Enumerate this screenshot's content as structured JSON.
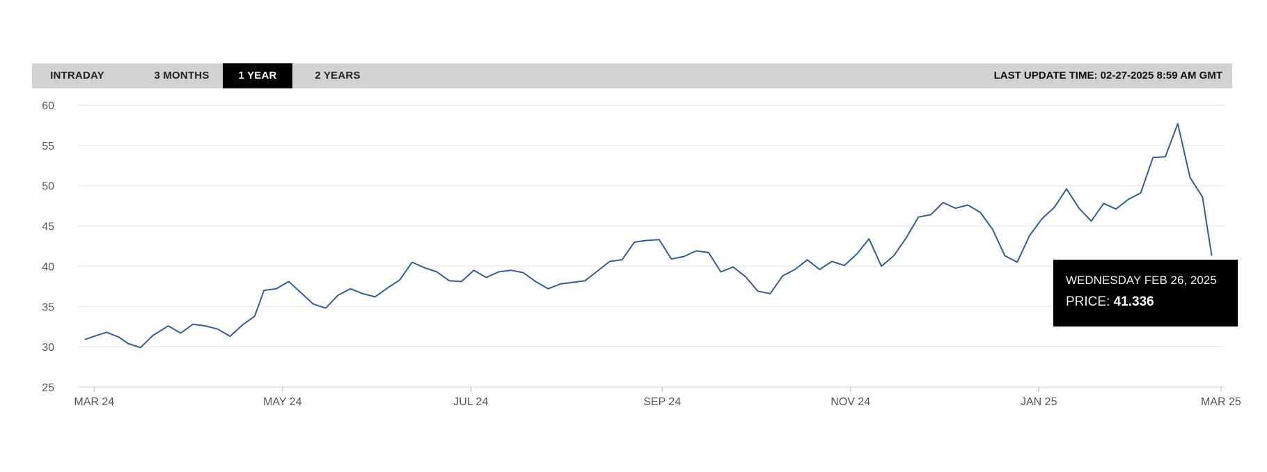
{
  "toolbar": {
    "tabs": [
      {
        "label": "INTRADAY",
        "active": false
      },
      {
        "label": "3 MONTHS",
        "active": false
      },
      {
        "label": "1 YEAR",
        "active": true
      },
      {
        "label": "2 YEARS",
        "active": false
      }
    ],
    "last_update": "LAST UPDATE TIME: 02-27-2025 8:59 AM GMT"
  },
  "tooltip": {
    "date": "WEDNESDAY FEB 26, 2025",
    "price_label": "PRICE:",
    "price_value": "41.336"
  },
  "colors": {
    "line": "#2f5d9e",
    "grid": "#e6e6e6",
    "toolbar": "#d2d2d2",
    "active_tab": "#000000"
  },
  "chart_data": {
    "type": "line",
    "ylim": [
      25,
      60
    ],
    "yticks": [
      25,
      30,
      35,
      40,
      45,
      50,
      55,
      60
    ],
    "xlim": [
      "2024-02-27",
      "2025-02-27"
    ],
    "xticks": [
      {
        "label": "MAR 24",
        "date": "2024-03-01"
      },
      {
        "label": "MAY 24",
        "date": "2024-05-01"
      },
      {
        "label": "JUL 24",
        "date": "2024-07-01"
      },
      {
        "label": "SEP 24",
        "date": "2024-09-01"
      },
      {
        "label": "NOV 24",
        "date": "2024-11-01"
      },
      {
        "label": "JAN 25",
        "date": "2025-01-01"
      },
      {
        "label": "MAR 25",
        "date": "2025-03-01"
      }
    ],
    "grid": true,
    "series": [
      {
        "x": [
          "2024-02-27",
          "2024-03-01",
          "2024-03-05",
          "2024-03-09",
          "2024-03-12",
          "2024-03-16",
          "2024-03-20",
          "2024-03-25",
          "2024-03-29",
          "2024-04-02",
          "2024-04-06",
          "2024-04-10",
          "2024-04-14",
          "2024-04-18",
          "2024-04-22",
          "2024-04-25",
          "2024-04-29",
          "2024-05-03",
          "2024-05-07",
          "2024-05-11",
          "2024-05-15",
          "2024-05-19",
          "2024-05-23",
          "2024-05-27",
          "2024-05-31",
          "2024-06-04",
          "2024-06-08",
          "2024-06-12",
          "2024-06-16",
          "2024-06-20",
          "2024-06-24",
          "2024-06-28",
          "2024-07-02",
          "2024-07-06",
          "2024-07-10",
          "2024-07-14",
          "2024-07-18",
          "2024-07-22",
          "2024-07-26",
          "2024-07-30",
          "2024-08-03",
          "2024-08-07",
          "2024-08-11",
          "2024-08-15",
          "2024-08-19",
          "2024-08-23",
          "2024-08-27",
          "2024-08-31",
          "2024-09-04",
          "2024-09-08",
          "2024-09-12",
          "2024-09-16",
          "2024-09-20",
          "2024-09-24",
          "2024-09-28",
          "2024-10-02",
          "2024-10-06",
          "2024-10-10",
          "2024-10-14",
          "2024-10-18",
          "2024-10-22",
          "2024-10-26",
          "2024-10-30",
          "2024-11-03",
          "2024-11-07",
          "2024-11-11",
          "2024-11-15",
          "2024-11-19",
          "2024-11-23",
          "2024-11-27",
          "2024-12-01",
          "2024-12-05",
          "2024-12-09",
          "2024-12-13",
          "2024-12-17",
          "2024-12-21",
          "2024-12-25",
          "2024-12-29",
          "2025-01-02",
          "2025-01-06",
          "2025-01-10",
          "2025-01-14",
          "2025-01-18",
          "2025-01-22",
          "2025-01-26",
          "2025-01-30",
          "2025-02-03",
          "2025-02-07",
          "2025-02-11",
          "2025-02-15",
          "2025-02-19",
          "2025-02-23",
          "2025-02-26"
        ],
        "y": [
          30.9,
          31.3,
          31.8,
          31.2,
          30.4,
          29.9,
          31.4,
          32.6,
          31.7,
          32.8,
          32.6,
          32.2,
          31.3,
          32.7,
          33.8,
          37.0,
          37.2,
          38.1,
          36.7,
          35.3,
          34.8,
          36.4,
          37.2,
          36.6,
          36.2,
          37.3,
          38.3,
          40.5,
          39.8,
          39.3,
          38.2,
          38.1,
          39.5,
          38.6,
          39.3,
          39.5,
          39.2,
          38.1,
          37.2,
          37.8,
          38.0,
          38.2,
          39.4,
          40.6,
          40.8,
          43.0,
          43.2,
          43.3,
          40.9,
          41.2,
          41.9,
          41.7,
          39.3,
          39.9,
          38.7,
          36.9,
          36.6,
          38.8,
          39.6,
          40.8,
          39.6,
          40.6,
          40.1,
          41.5,
          43.4,
          40.0,
          41.3,
          43.5,
          46.1,
          46.4,
          47.9,
          47.2,
          47.6,
          46.7,
          44.6,
          41.3,
          40.5,
          43.8,
          45.9,
          47.3,
          49.6,
          47.2,
          45.6,
          47.8,
          47.1,
          48.3,
          49.1,
          53.5,
          53.6,
          57.7,
          51.0,
          48.6,
          41.3
        ]
      }
    ]
  }
}
